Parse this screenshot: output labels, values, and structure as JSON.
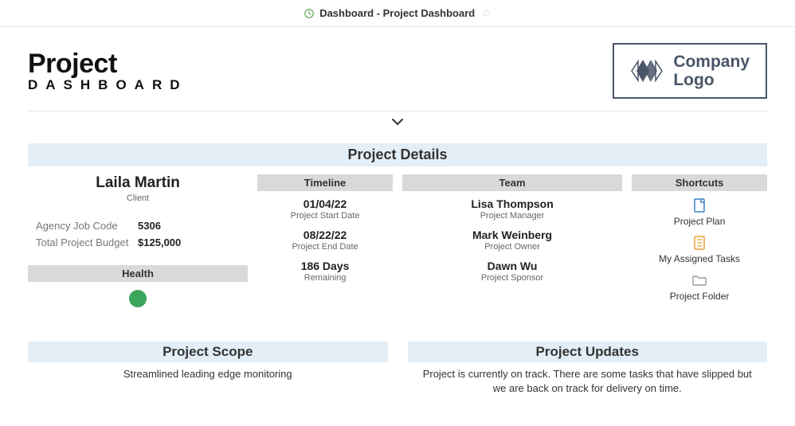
{
  "topbar": {
    "title": "Dashboard - Project Dashboard"
  },
  "header": {
    "title_line1": "Project",
    "title_line2": "DASHBOARD",
    "company_logo_line1": "Company",
    "company_logo_line2": "Logo"
  },
  "project_details": {
    "banner": "Project Details",
    "client": {
      "name": "Laila Martin",
      "role": "Client",
      "agency_code_label": "Agency Job Code",
      "agency_code_value": "5306",
      "budget_label": "Total Project Budget",
      "budget_value": "$125,000",
      "health_label": "Health",
      "health_color": "#3ba55d"
    },
    "timeline": {
      "banner": "Timeline",
      "start_date": "01/04/22",
      "start_label": "Project Start Date",
      "end_date": "08/22/22",
      "end_label": "Project End Date",
      "remaining": "186 Days",
      "remaining_label": "Remaining"
    },
    "team": {
      "banner": "Team",
      "members": [
        {
          "name": "Lisa Thompson",
          "role": "Project Manager"
        },
        {
          "name": "Mark Weinberg",
          "role": "Project Owner"
        },
        {
          "name": "Dawn Wu",
          "role": "Project Sponsor"
        }
      ]
    },
    "shortcuts": {
      "banner": "Shortcuts",
      "items": [
        {
          "label": "Project Plan",
          "icon": "doc"
        },
        {
          "label": "My Assigned Tasks",
          "icon": "tasks"
        },
        {
          "label": "Project Folder",
          "icon": "folder"
        }
      ]
    }
  },
  "project_scope": {
    "banner": "Project Scope",
    "text": "Streamlined leading edge monitoring"
  },
  "project_updates": {
    "banner": "Project Updates",
    "text": "Project is currently on track. There are some tasks that have slipped but we are back on track for delivery on time."
  }
}
